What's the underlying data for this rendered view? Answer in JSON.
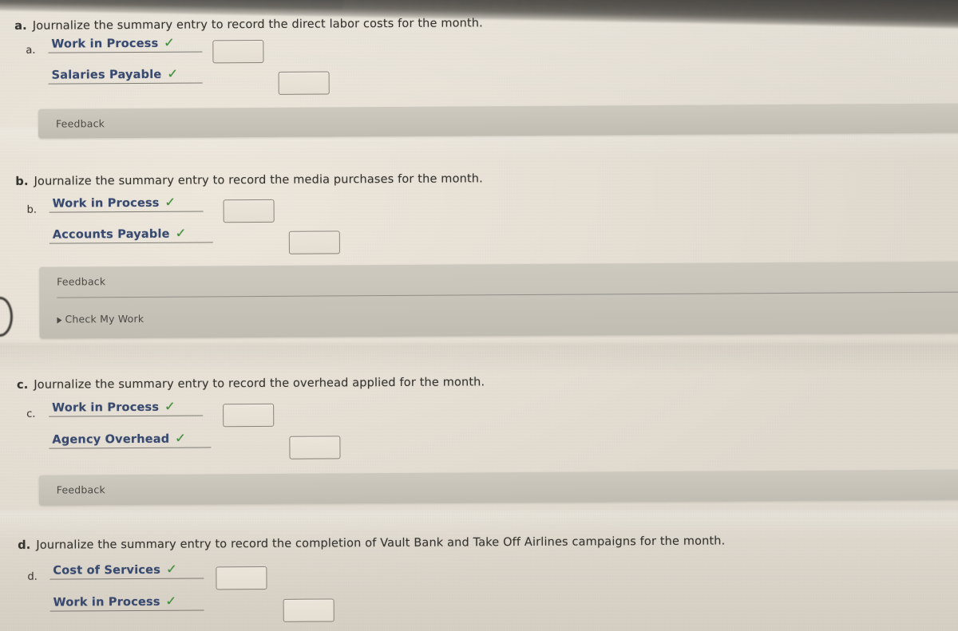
{
  "colors": {
    "page_background": "#e3ddd2",
    "account_text": "#38496f",
    "check_mark": "#3f8f3a",
    "feedback_bar": "#c6c2b8",
    "prompt_text": "#35332f",
    "input_border": "#8a8378"
  },
  "sections": [
    {
      "tag": "a.",
      "prompt": "Journalize the summary entry to record the direct labor costs for the month.",
      "entry_label": "a.",
      "lines": [
        {
          "account": "Work in Process",
          "status_icon": "check-mark",
          "amount": ""
        },
        {
          "account": "Salaries Payable",
          "status_icon": "check-mark",
          "amount": ""
        }
      ],
      "feedback": {
        "label": "Feedback",
        "check_my_work": null
      }
    },
    {
      "tag": "b.",
      "prompt": "Journalize the summary entry to record the media purchases for the month.",
      "entry_label": "b.",
      "lines": [
        {
          "account": "Work in Process",
          "status_icon": "check-mark",
          "amount": ""
        },
        {
          "account": "Accounts Payable",
          "status_icon": "check-mark",
          "amount": ""
        }
      ],
      "feedback": {
        "label": "Feedback",
        "check_my_work": "Check My Work"
      }
    },
    {
      "tag": "c.",
      "prompt": "Journalize the summary entry to record the overhead applied for the month.",
      "entry_label": "c.",
      "lines": [
        {
          "account": "Work in Process",
          "status_icon": "check-mark",
          "amount": ""
        },
        {
          "account": "Agency Overhead",
          "status_icon": "check-mark",
          "amount": ""
        }
      ],
      "feedback": {
        "label": "Feedback",
        "check_my_work": null
      }
    },
    {
      "tag": "d.",
      "prompt": "Journalize the summary entry to record the completion of Vault Bank and Take Off Airlines campaigns for the month.",
      "entry_label": "d.",
      "lines": [
        {
          "account": "Cost of Services",
          "status_icon": "check-mark",
          "amount": ""
        },
        {
          "account": "Work in Process",
          "status_icon": "check-mark",
          "amount": ""
        }
      ],
      "feedback": null
    }
  ],
  "glyphs": {
    "check": "✓"
  }
}
